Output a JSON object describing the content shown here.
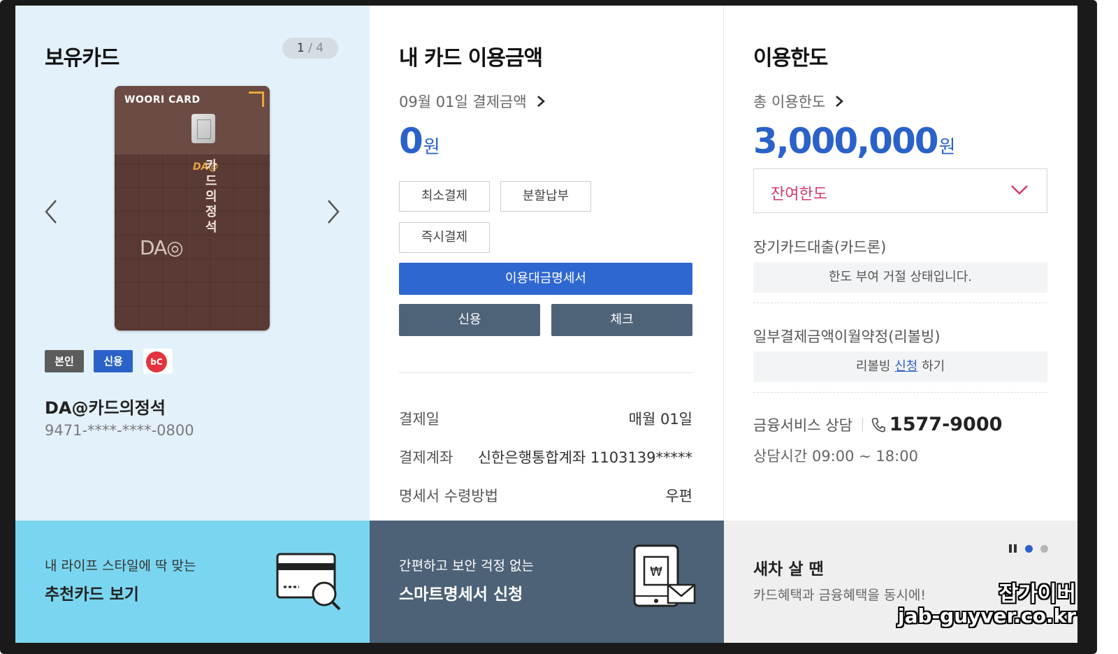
{
  "card_panel": {
    "title": "보유카드",
    "pager": {
      "current": "1",
      "separator": "/",
      "total": "4"
    },
    "card": {
      "brand": "WOORI CARD",
      "design_text": "카드의 정석",
      "design_mark": "DA@",
      "logo": "DA◎"
    },
    "badges": {
      "self": "본인",
      "credit": "신용",
      "network": "bC"
    },
    "card_name": "DA@카드의정석",
    "card_number": "9471-****-****-0800"
  },
  "usage_panel": {
    "title": "내 카드 이용금액",
    "payment_link": "09월 01일 결제금액",
    "amount": "0",
    "currency": "원",
    "buttons": {
      "min_payment": "최소결제",
      "installment": "분할납부",
      "instant_payment": "즉시결제",
      "statement": "이용대금명세서",
      "credit": "신용",
      "check": "체크"
    },
    "info": [
      {
        "label": "결제일",
        "value": "매월 01일"
      },
      {
        "label": "결제계좌",
        "value": "신한은행통합계좌 1103139*****"
      },
      {
        "label": "명세서 수령방법",
        "value": "우편"
      }
    ]
  },
  "limit_panel": {
    "title": "이용한도",
    "total_link": "총 이용한도",
    "amount": "3,000,000",
    "currency": "원",
    "dropdown": "잔여한도",
    "loan_label": "장기카드대출(카드론)",
    "loan_status": "한도 부여 거절 상태입니다.",
    "revolving_label": "일부결제금액이월약정(리볼빙)",
    "revolving_pre": "리볼빙 ",
    "revolving_link": "신청",
    "revolving_post": " 하기",
    "consult_label": "금융서비스 상담",
    "consult_phone": "1577-9000",
    "consult_hours": "상담시간 09:00 ~ 18:00"
  },
  "banners": {
    "recommend": {
      "sub": "내 라이프 스타일에 딱 맞는",
      "main": "추천카드 보기"
    },
    "smart": {
      "sub": "간편하고 보안 걱정 없는",
      "main": "스마트명세서 신청"
    },
    "car": {
      "main": "새차 살 땐",
      "sub": "카드혜택과 금융혜택을 동시에!"
    }
  },
  "watermark": {
    "line1": "잡가이버",
    "line2": "jab-guyver.co.kr"
  },
  "colors": {
    "accent_blue": "#2a62c9",
    "slate": "#4f6378",
    "pink": "#d6396b",
    "light_blue_bg": "#e3f1fb"
  }
}
